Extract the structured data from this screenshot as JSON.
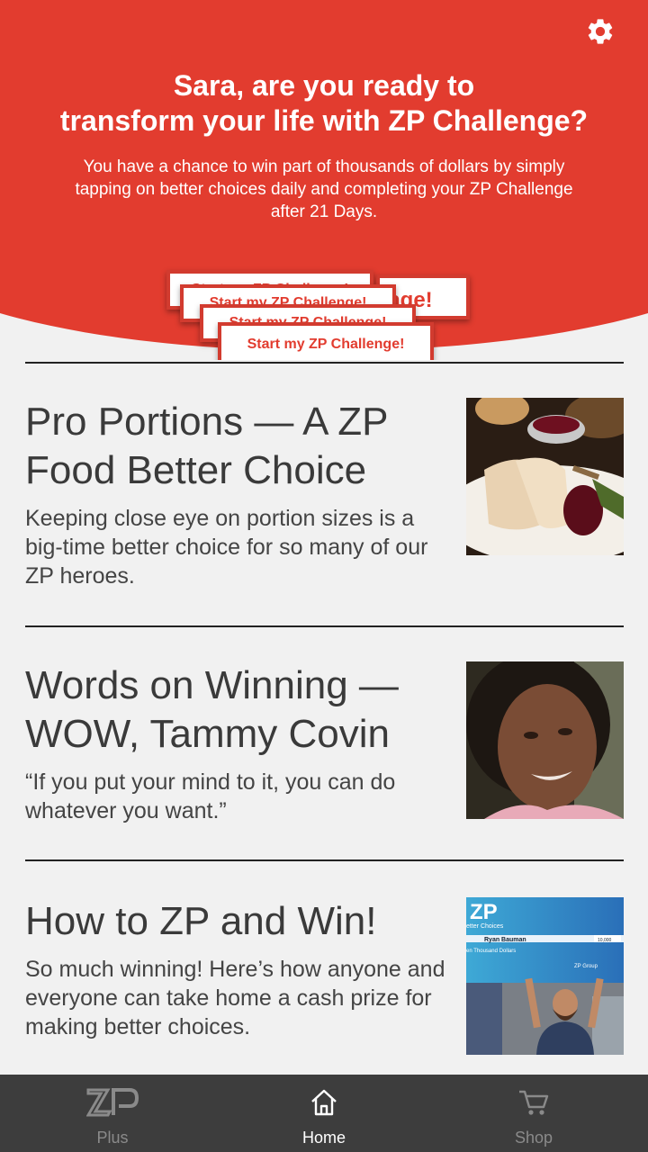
{
  "header": {
    "title_line1": "Sara, are you ready to",
    "title_line2": "transform your life with ZP Challenge?",
    "subtitle": "You have a chance to win part of thousands of dollars by simply tapping on better choices daily and completing your ZP Challenge after 21 Days.",
    "cta_label": "Start my ZP Challenge!",
    "cta_fragment": "nge!"
  },
  "articles": [
    {
      "title": "Pro Portions — A ZP Food Better Choice",
      "description": "Keeping close eye on portion sizes is a big-time better choice for so many of our ZP heroes."
    },
    {
      "title": "Words on Winning — WOW, Tammy Covin",
      "description": "“If you put your mind to it, you can do whatever you want.”"
    },
    {
      "title": "How to ZP and Win!",
      "description": "So much winning! Here’s how anyone and everyone can take home a cash prize for making better choices."
    }
  ],
  "check_image": {
    "brand": "ZP",
    "line1": "etter Choices",
    "payee": "Ryan Bauman",
    "amount_words": "en Thousand Dollars",
    "amount": "10,000",
    "signer": "ZP Group"
  },
  "nav": {
    "plus_label": "Plus",
    "home_label": "Home",
    "shop_label": "Shop"
  },
  "colors": {
    "accent": "#e23c2f",
    "nav_bg": "#3d3d3d",
    "nav_active": "#ffffff",
    "nav_inactive": "#8a8a8a"
  }
}
